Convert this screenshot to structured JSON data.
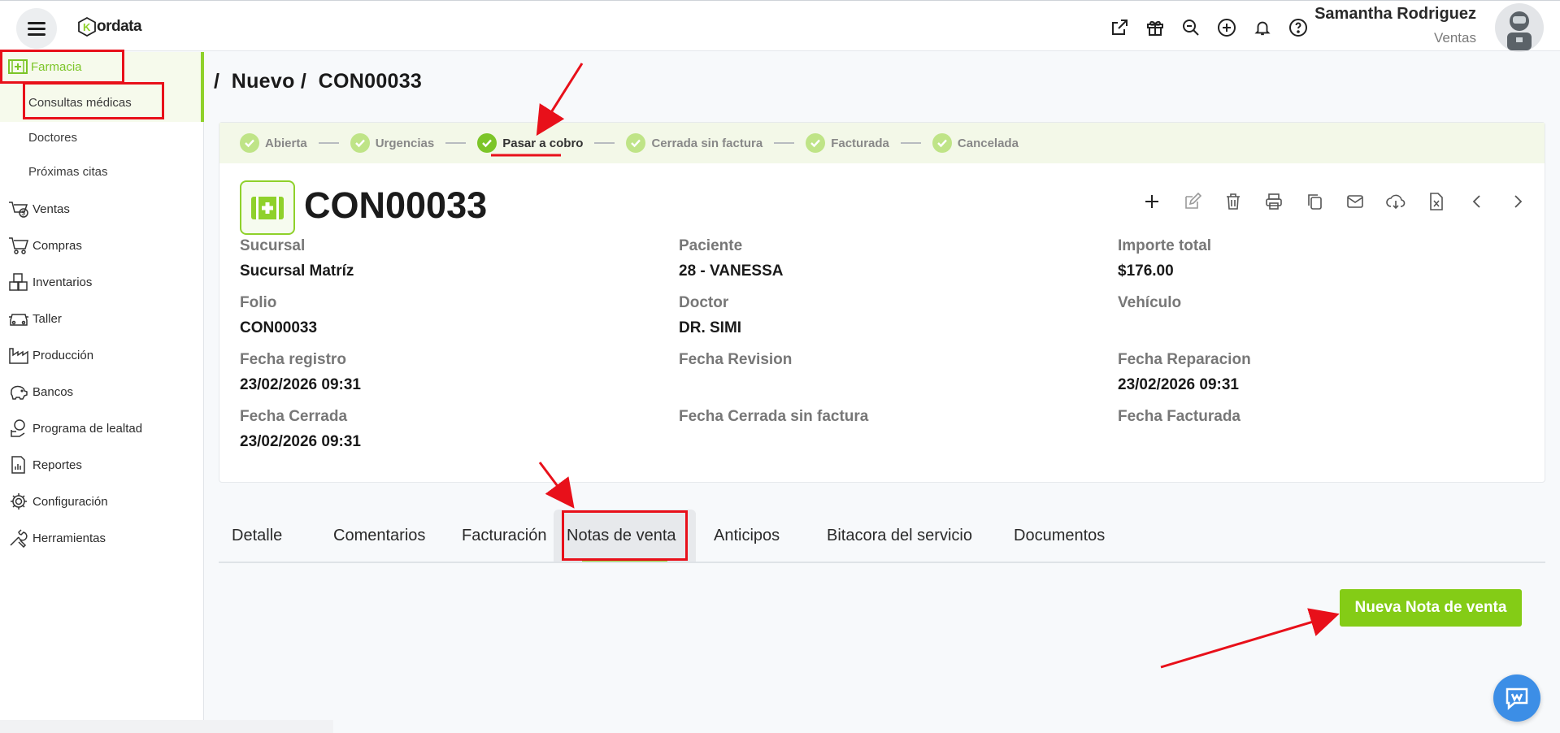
{
  "app": {
    "logo_text": "ordata",
    "user_name": "Samantha Rodriguez",
    "user_role": "Ventas"
  },
  "top_icons": [
    "external-link-icon",
    "gift-icon",
    "search-zoom-icon",
    "plus-circle-icon",
    "bell-icon",
    "help-icon"
  ],
  "sidebar": {
    "items": [
      {
        "label": "Farmacia",
        "icon": "pharmacy-icon"
      },
      {
        "label": "Ventas",
        "icon": "sales-icon"
      },
      {
        "label": "Compras",
        "icon": "cart-icon"
      },
      {
        "label": "Inventarios",
        "icon": "boxes-icon"
      },
      {
        "label": "Taller",
        "icon": "car-icon"
      },
      {
        "label": "Producción",
        "icon": "factory-icon"
      },
      {
        "label": "Bancos",
        "icon": "piggy-bank-icon"
      },
      {
        "label": "Programa de lealtad",
        "icon": "loyalty-icon"
      },
      {
        "label": "Reportes",
        "icon": "report-icon"
      },
      {
        "label": "Configuración",
        "icon": "gear-icon"
      },
      {
        "label": "Herramientas",
        "icon": "tools-icon"
      }
    ],
    "subitems": [
      {
        "label": "Consultas médicas"
      },
      {
        "label": "Doctores"
      },
      {
        "label": "Próximas citas"
      }
    ]
  },
  "breadcrumb": {
    "sep": "/",
    "part1": "Nuevo",
    "part2": "CON00033"
  },
  "stepper": [
    {
      "label": "Abierta"
    },
    {
      "label": "Urgencias"
    },
    {
      "label": "Pasar a cobro"
    },
    {
      "label": "Cerrada sin factura"
    },
    {
      "label": "Facturada"
    },
    {
      "label": "Cancelada"
    }
  ],
  "record": {
    "title": "CON00033",
    "fields": [
      {
        "label": "Sucursal",
        "value": "Sucursal Matríz"
      },
      {
        "label": "Paciente",
        "value": "28 - VANESSA"
      },
      {
        "label": "Importe total",
        "value": "$176.00"
      },
      {
        "label": "Folio",
        "value": "CON00033"
      },
      {
        "label": "Doctor",
        "value": "DR. SIMI"
      },
      {
        "label": "Vehículo",
        "value": ""
      },
      {
        "label": "Fecha registro",
        "value": "23/02/2026 09:31"
      },
      {
        "label": "Fecha Revision",
        "value": ""
      },
      {
        "label": "Fecha Reparacion",
        "value": "23/02/2026 09:31"
      },
      {
        "label": "Fecha Cerrada",
        "value": "23/02/2026 09:31"
      },
      {
        "label": "Fecha Cerrada sin factura",
        "value": ""
      },
      {
        "label": "Fecha Facturada",
        "value": ""
      }
    ]
  },
  "actions": [
    "add-icon",
    "edit-icon",
    "delete-icon",
    "print-icon",
    "copy-icon",
    "email-icon",
    "download-icon",
    "excel-icon",
    "prev-icon",
    "next-icon"
  ],
  "tabs": [
    {
      "label": "Detalle"
    },
    {
      "label": "Comentarios"
    },
    {
      "label": "Facturación"
    },
    {
      "label": "Notas de venta"
    },
    {
      "label": "Anticipos"
    },
    {
      "label": "Bitacora del servicio"
    },
    {
      "label": "Documentos"
    }
  ],
  "new_button_label": "Nueva Nota de venta",
  "colors": {
    "accent": "#84cc16",
    "annotation": "#e8101a"
  }
}
